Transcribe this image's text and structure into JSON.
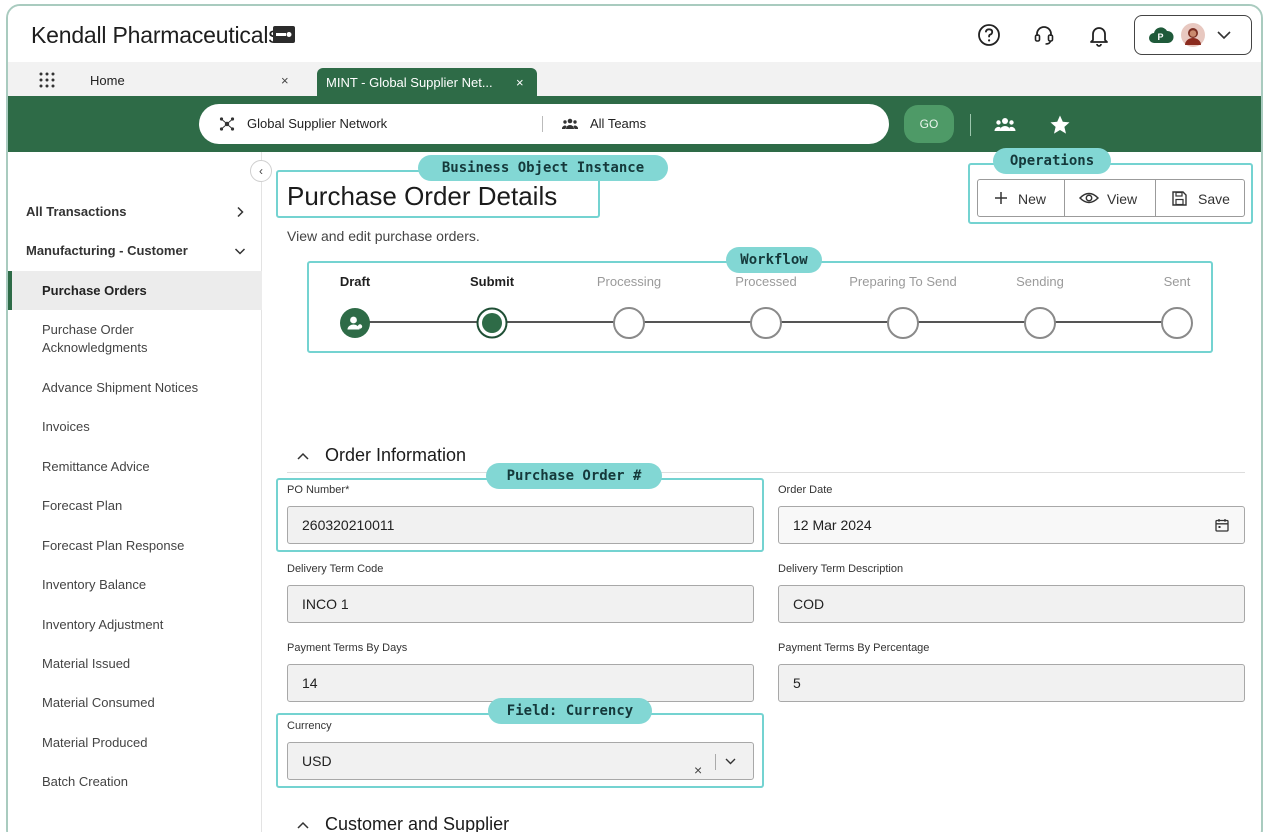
{
  "app": {
    "name": "Kendall Pharmaceuticals"
  },
  "tabs": {
    "home": "Home",
    "home_close": "×",
    "active": "MINT - Global Supplier Net...",
    "active_close": "×"
  },
  "search": {
    "network": "Global Supplier Network",
    "teams": "All Teams",
    "go": "GO"
  },
  "sidebar": {
    "collapse": "‹",
    "groups": [
      "All Transactions",
      "Manufacturing - Customer"
    ],
    "items": [
      "Purchase Orders",
      "Purchase Order\nAcknowledgments",
      "Advance Shipment Notices",
      "Invoices",
      "Remittance Advice",
      "Forecast Plan",
      "Forecast Plan Response",
      "Inventory Balance",
      "Inventory Adjustment",
      "Material Issued",
      "Material Consumed",
      "Material Produced",
      "Batch Creation"
    ]
  },
  "page": {
    "title": "Purchase Order Details",
    "subtitle": "View and edit purchase orders."
  },
  "operations": {
    "new": "New",
    "view": "View",
    "save": "Save"
  },
  "annotations": {
    "business_object": "Business Object Instance",
    "operations": "Operations",
    "workflow": "Workflow",
    "po_number": "Purchase Order #",
    "currency": "Field: Currency"
  },
  "workflow": {
    "steps": [
      "Draft",
      "Submit",
      "Processing",
      "Processed",
      "Preparing To Send",
      "Sending",
      "Sent"
    ]
  },
  "sections": {
    "order_info": "Order Information",
    "customer_supplier": "Customer and Supplier"
  },
  "fields": {
    "po_number": {
      "label": "PO Number*",
      "value": "260320210011"
    },
    "order_date": {
      "label": "Order Date",
      "value": "12 Mar 2024"
    },
    "delivery_term_code": {
      "label": "Delivery Term Code",
      "value": "INCO 1"
    },
    "delivery_term_desc": {
      "label": "Delivery Term Description",
      "value": "COD"
    },
    "payment_days": {
      "label": "Payment Terms By Days",
      "value": "14"
    },
    "payment_pct": {
      "label": "Payment Terms By Percentage",
      "value": "5"
    },
    "currency": {
      "label": "Currency",
      "value": "USD",
      "clear": "×"
    }
  },
  "colors": {
    "brand_green": "#2e6b47",
    "go_green": "#4e9a67",
    "annotation": "#82d7d4"
  }
}
